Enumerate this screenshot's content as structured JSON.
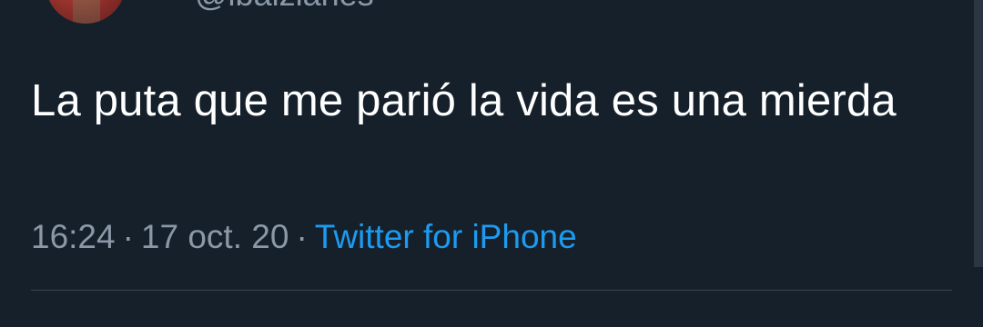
{
  "tweet": {
    "author_handle": "@ibaizlanes",
    "text": "La puta que me parió la vida es una mierda",
    "time": "16:24",
    "date": "17 oct. 20",
    "separator": "·",
    "source": "Twitter for iPhone"
  },
  "colors": {
    "background": "#15202b",
    "text_primary": "#ffffff",
    "text_secondary": "#8b98a5",
    "link": "#1d9bf0",
    "divider": "#38444d"
  }
}
